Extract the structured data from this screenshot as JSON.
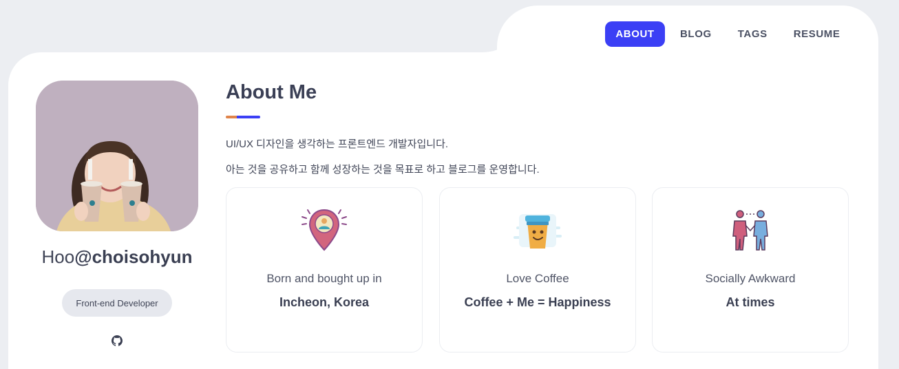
{
  "nav": {
    "items": [
      {
        "label": "ABOUT",
        "active": true
      },
      {
        "label": "BLOG",
        "active": false
      },
      {
        "label": "TAGS",
        "active": false
      },
      {
        "label": "RESUME",
        "active": false
      }
    ],
    "accent": "#3b3ff5"
  },
  "profile": {
    "handle_prefix": "Hoo",
    "handle_name": "@choisohyun",
    "role": "Front-end Developer",
    "links": [
      {
        "icon": "github-icon"
      }
    ]
  },
  "about": {
    "title": "About Me",
    "intro": [
      "UI/UX 디자인을 생각하는 프론트엔드 개발자입니다.",
      "아는 것을 공유하고 함께 성장하는 것을 목표로 하고 블로그를 운영합니다."
    ],
    "underline_colors": [
      "#e0844a",
      "#3b3ff5"
    ]
  },
  "features": [
    {
      "icon": "location-pin-icon",
      "caption": "Born and bought up in",
      "value": "Incheon, Korea"
    },
    {
      "icon": "coffee-cup-icon",
      "caption": "Love Coffee",
      "value": "Coffee + Me = Happiness"
    },
    {
      "icon": "people-handshake-icon",
      "caption": "Socially Awkward",
      "value": "At times"
    }
  ]
}
